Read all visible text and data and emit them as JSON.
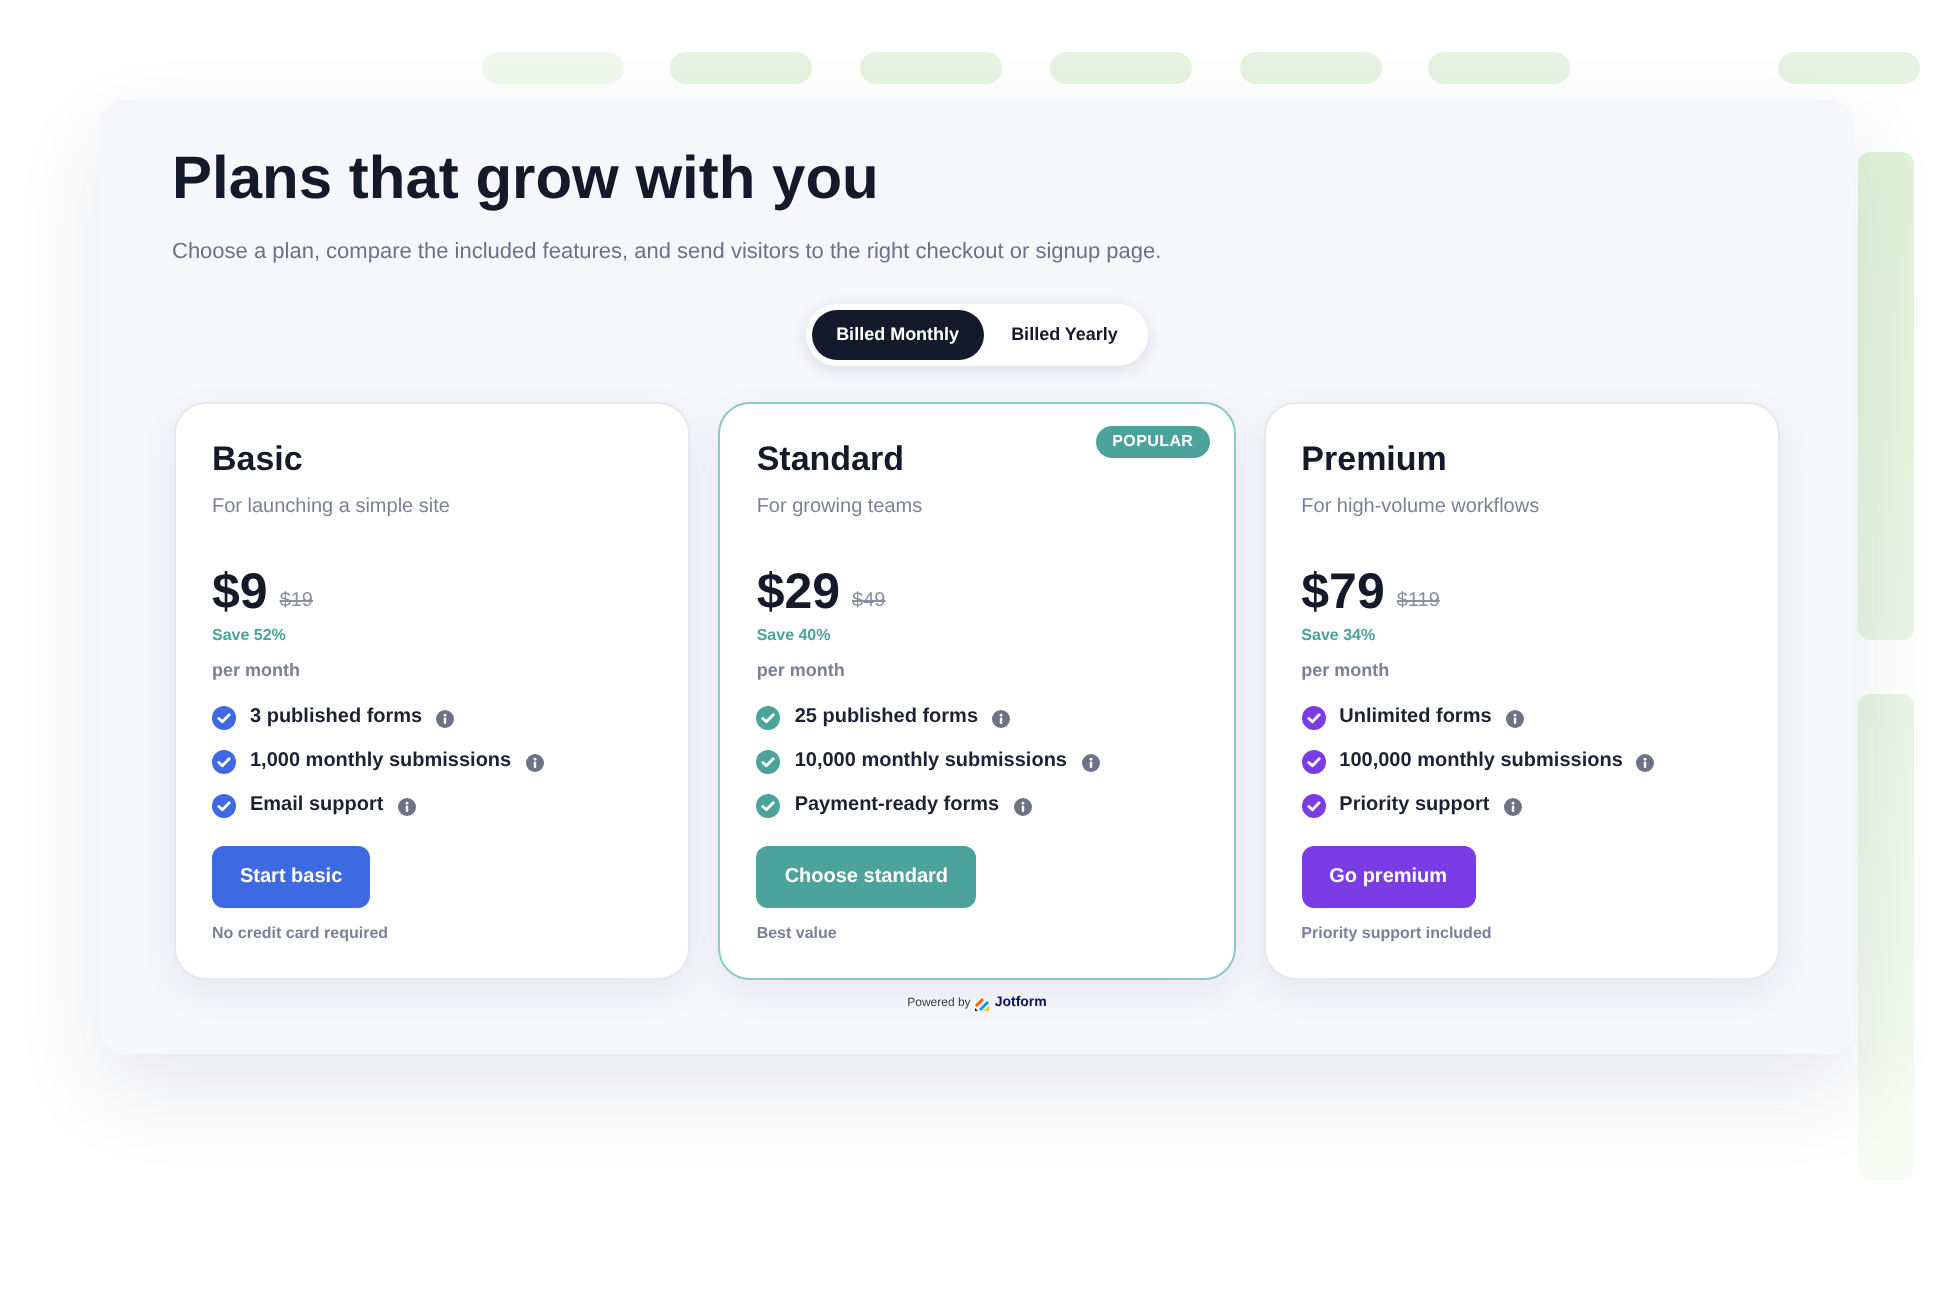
{
  "header": {
    "title": "Plans that grow with you",
    "subtitle": "Choose a plan, compare the included features, and send visitors to the right checkout or signup page."
  },
  "billing_toggle": [
    {
      "label": "Billed Monthly",
      "selected": true
    },
    {
      "label": "Billed Yearly",
      "selected": false
    }
  ],
  "plans": [
    {
      "name": "Basic",
      "tagline": "For launching a simple site",
      "price": "$9",
      "old_price": "$19",
      "savings": "Save 52%",
      "period": "per month",
      "features": [
        "3 published forms",
        "1,000 monthly submissions",
        "Email support"
      ],
      "button": "Start basic",
      "note": "No credit card required",
      "color": "#3d6ae3",
      "featured": false
    },
    {
      "name": "Standard",
      "badge": "POPULAR",
      "tagline": "For growing teams",
      "price": "$29",
      "old_price": "$49",
      "savings": "Save 40%",
      "period": "per month",
      "features": [
        "25 published forms",
        "10,000 monthly submissions",
        "Payment-ready forms"
      ],
      "button": "Choose standard",
      "note": "Best value",
      "color": "#4ba39b",
      "featured": true
    },
    {
      "name": "Premium",
      "tagline": "For high-volume workflows",
      "price": "$79",
      "old_price": "$119",
      "savings": "Save 34%",
      "period": "per month",
      "features": [
        "Unlimited forms",
        "100,000 monthly submissions",
        "Priority support"
      ],
      "button": "Go premium",
      "note": "Priority support included",
      "color": "#7b3ce6",
      "featured": false
    }
  ],
  "footer": {
    "powered_by": "Powered by",
    "brand": "Jotform"
  }
}
